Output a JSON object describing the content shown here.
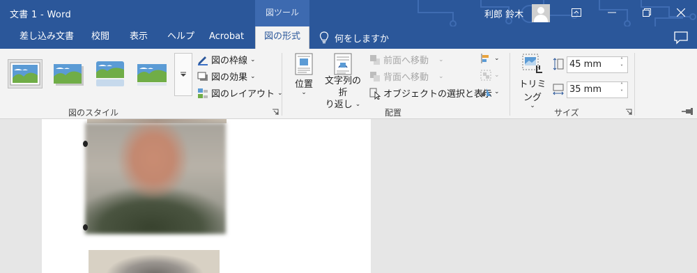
{
  "titlebar": {
    "title": "文書 1  -  Word",
    "context_tab": "図ツール",
    "user_name": "利郎 鈴木",
    "colors": {
      "bar": "#2b579a",
      "context": "#3d6ab0"
    }
  },
  "tabs": [
    {
      "label": "差し込み文書"
    },
    {
      "label": "校閲"
    },
    {
      "label": "表示"
    },
    {
      "label": "ヘルプ"
    },
    {
      "label": "Acrobat"
    },
    {
      "label": "図の形式",
      "active": true
    }
  ],
  "tell_me": {
    "label": "何をしますか",
    "icon": "lightbulb-icon"
  },
  "ribbon": {
    "picture_styles": {
      "label": "図のスタイル",
      "border": "図の枠線",
      "effects": "図の効果",
      "layout": "図のレイアウト"
    },
    "arrange": {
      "label": "配置",
      "position": "位置",
      "wrap_text_line1": "文字列の折",
      "wrap_text_line2": "り返し",
      "bring_forward": "前面へ移動",
      "send_backward": "背面へ移動",
      "selection_pane": "オブジェクトの選択と表示"
    },
    "size": {
      "label": "サイズ",
      "crop": "トリミング",
      "height": "45 mm",
      "width": "35 mm"
    }
  }
}
